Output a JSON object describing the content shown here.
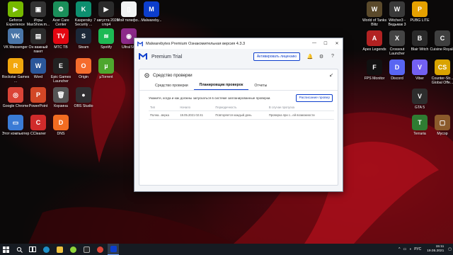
{
  "desktop": {
    "icons": [
      {
        "label": "Geforce Experience",
        "color": "#76b900",
        "glyph": "▶",
        "icon": "geforce-icon"
      },
      {
        "label": "Игры MaxShow.m...",
        "color": "#333333",
        "glyph": "▣",
        "icon": "game-shortcut-icon"
      },
      {
        "label": "Acer Care Center",
        "color": "#1a8f5a",
        "glyph": "⚙",
        "icon": "acer-care-icon"
      },
      {
        "label": "Kaspersky Security ...",
        "color": "#0d8f6f",
        "glyph": "K",
        "icon": "kaspersky-icon"
      },
      {
        "label": "7 августа 2020 г.mp4",
        "color": "#2b2b2b",
        "glyph": "▶",
        "icon": "video-file-icon"
      },
      {
        "label": "Мой телефо...",
        "color": "#f2f2f2",
        "glyph": "▯",
        "icon": "document-icon"
      },
      {
        "label": "Malwareby...",
        "color": "#0d3ecc",
        "glyph": "M",
        "icon": "malwarebytes-icon"
      },
      {
        "label": "VK Messenger",
        "color": "#4a76a8",
        "glyph": "VK",
        "icon": "vk-icon"
      },
      {
        "label": "Он важный пакет",
        "color": "#2d2d2d",
        "glyph": "▤",
        "icon": "file-icon"
      },
      {
        "label": "МТС ТВ",
        "color": "#e30611",
        "glyph": "TV",
        "icon": "mts-tv-icon"
      },
      {
        "label": "Steam",
        "color": "#1b2838",
        "glyph": "S",
        "icon": "steam-icon"
      },
      {
        "label": "Spotify",
        "color": "#1db954",
        "glyph": "≋",
        "icon": "spotify-icon"
      },
      {
        "label": "UltraISO",
        "color": "#8d2a8a",
        "glyph": "◉",
        "icon": "ultraiso-icon"
      },
      {
        "label": "Rockstar Games ...",
        "color": "#f3a70d",
        "glyph": "R",
        "icon": "rockstar-icon"
      },
      {
        "label": "Word",
        "color": "#2b579a",
        "glyph": "W",
        "icon": "word-icon"
      },
      {
        "label": "Epic Games Launcher",
        "color": "#222222",
        "glyph": "E",
        "icon": "epic-games-icon"
      },
      {
        "label": "Origin",
        "color": "#f56c2d",
        "glyph": "O",
        "icon": "origin-icon"
      },
      {
        "label": "µTorrent",
        "color": "#4ea72e",
        "glyph": "µ",
        "icon": "utorrent-icon"
      },
      {
        "label": "Google Chrome",
        "color": "#db4437",
        "glyph": "◎",
        "icon": "chrome-icon"
      },
      {
        "label": "PowerPoint",
        "color": "#d24726",
        "glyph": "P",
        "icon": "powerpoint-icon"
      },
      {
        "label": "Корзина",
        "color": "#555555",
        "glyph": "🗑",
        "icon": "recycle-bin-icon"
      },
      {
        "label": "OBS Studio",
        "color": "#302e31",
        "glyph": "●",
        "icon": "obs-icon"
      },
      {
        "label": "Этот компьютер",
        "color": "#3a7bd5",
        "glyph": "▭",
        "icon": "this-pc-icon"
      },
      {
        "label": "CCleaner",
        "color": "#d02b2b",
        "glyph": "C",
        "icon": "ccleaner-icon"
      },
      {
        "label": "DNS",
        "color": "#f26c21",
        "glyph": "D",
        "icon": "dns-icon"
      },
      {
        "label": "World of Tanks Blitz",
        "color": "#5b4a2b",
        "glyph": "W",
        "icon": "wot-blitz-icon"
      },
      {
        "label": "Witcher3 - Ведьмак 3",
        "color": "#3a3a3a",
        "glyph": "W",
        "icon": "witcher-icon"
      },
      {
        "label": "PUBG LITE",
        "color": "#e5a100",
        "glyph": "P",
        "icon": "pubg-lite-icon"
      },
      {
        "label": "Apex Legends",
        "color": "#b22222",
        "glyph": "A",
        "icon": "apex-icon"
      },
      {
        "label": "Crossout Launcher",
        "color": "#444444",
        "glyph": "X",
        "icon": "crossout-icon"
      },
      {
        "label": "Blair Witch",
        "color": "#2a2a2a",
        "glyph": "B",
        "icon": "blair-witch-icon"
      },
      {
        "label": "Cuisine Royale",
        "color": "#3f3f3f",
        "glyph": "C",
        "icon": "cuisine-royale-icon"
      },
      {
        "label": "FPS Monitor",
        "color": "#111111",
        "glyph": "F",
        "icon": "fps-monitor-icon"
      },
      {
        "label": "Discord",
        "color": "#5865f2",
        "glyph": "D",
        "icon": "discord-icon"
      },
      {
        "label": "Viber",
        "color": "#7360f2",
        "glyph": "V",
        "icon": "viber-icon"
      },
      {
        "label": "Counter-Str... Global Offe...",
        "color": "#d9a300",
        "glyph": "CS",
        "icon": "csgo-icon"
      },
      {
        "label": "GTA 5",
        "color": "#2d2d2d",
        "glyph": "V",
        "icon": "gta5-icon"
      },
      {
        "label": "Terraria",
        "color": "#2f7d32",
        "glyph": "T",
        "icon": "terraria-icon"
      },
      {
        "label": "Мусор",
        "color": "#8b5a2b",
        "glyph": "▢",
        "icon": "trash-folder-icon"
      }
    ]
  },
  "window": {
    "title": "Malwarebytes Premium Ознакомительная версия  4.3.3",
    "controls": {
      "minimize": "—",
      "maximize": "☐",
      "close": "✕"
    },
    "trial_label": "Premium Trial",
    "license_button": "Активировать лицензию",
    "header_icons": {
      "bell": "🔔",
      "settings": "⚙",
      "help": "?"
    },
    "panel": {
      "title": "Средство проверки",
      "collapse": "↙",
      "tabs": [
        {
          "label": "Средство проверки"
        },
        {
          "label": "Планировщик проверок"
        },
        {
          "label": "Отчеты"
        }
      ],
      "active_tab": "Планировщик проверок",
      "description": "Укажите, когда и как должны запускаться в системе запланированные проверки.",
      "schedule_button": "Расписание провер",
      "columns": [
        "Тип",
        "Начало",
        "Периодичность",
        "В случае пропуска"
      ],
      "rows": [
        [
          "Полна...верка",
          "19.05.2021 02:41",
          "Повторяется каждый день",
          "Проверка при с...ей возможности"
        ]
      ]
    }
  },
  "taskbar": {
    "language": "РУС",
    "time": "15:11",
    "date": "19.05.2021"
  }
}
